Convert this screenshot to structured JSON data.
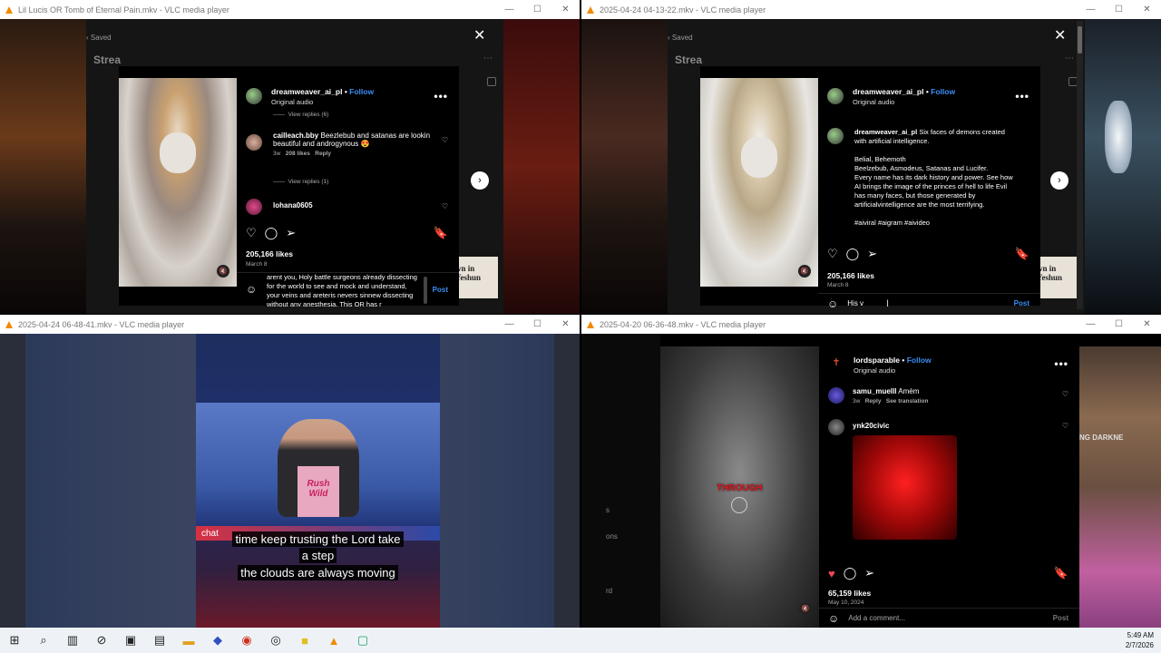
{
  "windows": {
    "w1": {
      "title": "Lil Lucis OR Tomb of Eternal Pain.mkv - VLC media player",
      "saved": "Saved",
      "stream": "Strea",
      "post": {
        "username": "dreamweaver_ai_pl",
        "follow": "Follow",
        "audio": "Original audio",
        "view_replies_1": "View replies (6)",
        "comment1_user": "cailleach.bby",
        "comment1_text": "Beezlebub and satanas are lookin beautiful and androgynous 😍",
        "comment1_meta": "3w",
        "comment1_likes": "208 likes",
        "comment1_reply": "Reply",
        "view_replies_2": "View replies (1)",
        "comment2_user": "lohana0605",
        "likes": "205,166 likes",
        "date": "March 8",
        "draft": "arent you, Holy battle surgeons already dissecting for the world to see and mock and understand, your veins and areteris nevers sinnew dissecting without any anesthesia, This OR has r",
        "post_label": "Post",
        "side_text": "wn in Yeshun"
      }
    },
    "w2": {
      "title": "2025-04-24 04-13-22.mkv - VLC media player",
      "saved": "Saved",
      "stream": "Strea",
      "post": {
        "username": "dreamweaver_ai_pl",
        "follow": "Follow",
        "audio": "Original audio",
        "caption_user": "dreamweaver_ai_pl",
        "caption_1": "Six faces of demons created with artificial intelligence.",
        "caption_2": "Belial, Behemoth",
        "caption_3": "Beelzebub, Asmodeus, Satanas and Lucifer.",
        "caption_4": "Every name has its dark history and power. See how AI brings the image of the princes of hell to life Evil has many faces, but those generated by artificialvintelligence are the most terrifying.",
        "caption_tags": "#aiviral #aigram #aivideo",
        "likes": "205,166 likes",
        "date": "March 8",
        "draft": "His v",
        "post_label": "Post",
        "side_text": "wn in Yeshun"
      }
    },
    "w3": {
      "title": "2025-04-24 06-48-41.mkv - VLC media player",
      "subtitle_1": "time keep trusting the Lord take",
      "subtitle_2": "a step",
      "subtitle_3": "the clouds are always moving",
      "chat": "chat",
      "shirt": "Rush Wild"
    },
    "w4": {
      "title": "2025-04-20 06-36-48.mkv - VLC media player",
      "overlay": "THROUGH",
      "side_words": [
        "s",
        "ons",
        "rd"
      ],
      "right_text": "NG DARKNE",
      "post": {
        "username": "lordsparable",
        "follow": "Follow",
        "audio": "Original audio",
        "comment1_user": "samu_muelll",
        "comment1_text": "Amém",
        "comment1_meta": "3w",
        "comment1_reply": "Reply",
        "comment1_translate": "See translation",
        "comment2_user": "ynk20civic",
        "likes": "65,159 likes",
        "date": "May 10, 2024",
        "placeholder": "Add a comment...",
        "post_label": "Post"
      }
    }
  },
  "taskbar": {
    "time": "5:49 AM",
    "date": "2/7/2026"
  },
  "colors": {
    "accent": "#3a8ff5",
    "vlc": "#f08a00",
    "like_red": "#ed4956"
  }
}
